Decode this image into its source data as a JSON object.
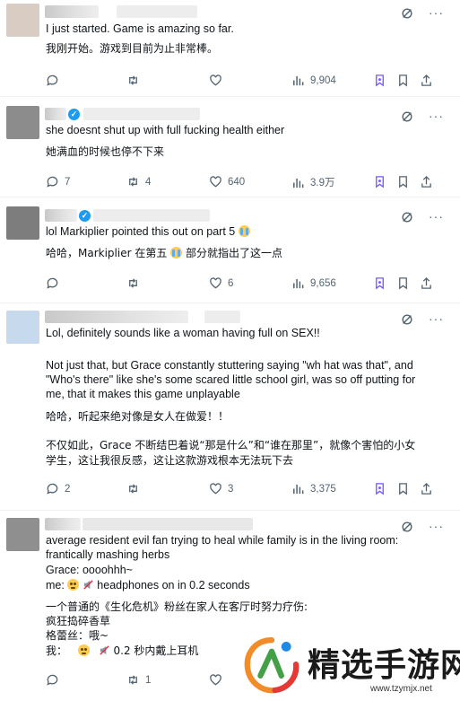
{
  "tweets": [
    {
      "lines": [
        "I just started. Game is amazing so far.",
        "我刚开始。游戏到目前为止非常棒。"
      ],
      "stats": {
        "replies": "",
        "reposts": "",
        "likes": "",
        "views": "9,904"
      }
    },
    {
      "lines": [
        "she doesnt shut up with full fucking health either",
        "她满血的时候也停不下来"
      ],
      "stats": {
        "replies": "7",
        "reposts": "4",
        "likes": "640",
        "views": "3.9万"
      }
    },
    {
      "lines": [],
      "line_a_prefix": "lol Markiplier pointed this out on part 5",
      "line_b_prefix": "哈哈，Markiplier 在第五",
      "line_b_suffix": "部分就指出了这一点",
      "stats": {
        "replies": "",
        "reposts": "",
        "likes": "6",
        "views": "9,656"
      }
    },
    {
      "lines": [
        "Lol, definitely sounds like a woman having full on SEX!!",
        "Not just that, but Grace constantly stuttering saying \"wh hat was that\", and",
        "\"Who's there\"  like she's some scared little school girl, was so off putting for",
        "me, that it makes this game unplayable",
        "哈哈，听起来绝对像是女人在做爱！！",
        "不仅如此，Grace 不断结巴着说“那是什么”和“谁在那里”，就像个害怕的小女",
        "学生，这让我很反感，这让这款游戏根本无法玩下去"
      ],
      "stats": {
        "replies": "2",
        "reposts": "",
        "likes": "3",
        "views": "3,375"
      }
    },
    {
      "lines": [
        "average resident evil fan trying to heal while family is in the living room:",
        "frantically mashing herbs",
        "Grace: oooohhh~",
        "一个普通的《生化危机》粉丝在家人在客厅时努力疗伤:",
        "疯狂捣碎香草",
        "格蕾丝：哦~"
      ],
      "me_prefix": "me:",
      "me_suffix": "headphones on in 0.2 seconds",
      "zh_me_prefix": "我：",
      "zh_me_suffix": "0.2 秒内戴上耳机",
      "stats": {
        "replies": "",
        "reposts": "1",
        "likes": "",
        "views": ""
      }
    }
  ],
  "watermark": {
    "title": "精选手游网",
    "url": "www.tzymjx.net"
  },
  "colors": {
    "accent": "#1d9bf0",
    "grok": "#7856ff",
    "muted": "#536471"
  }
}
